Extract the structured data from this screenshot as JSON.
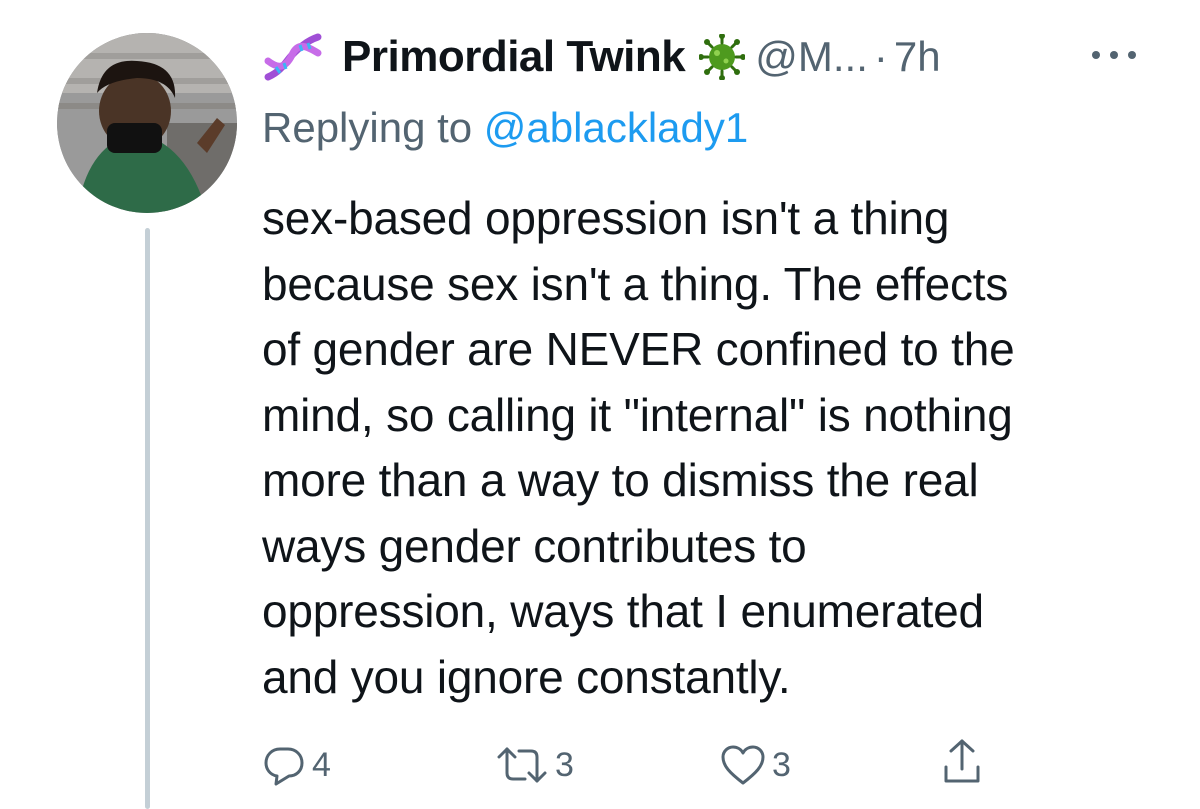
{
  "author": {
    "display_name": "Primordial Twink",
    "handle": "@M...",
    "separator": "·",
    "time": "7h",
    "name_emoji_left": "dna-icon",
    "name_emoji_right": "virus-icon"
  },
  "reply_context": {
    "prefix": "Replying to ",
    "mention": "@ablacklady1"
  },
  "tweet": {
    "text": "sex-based oppression isn't a thing\nbecause sex isn't a thing. The effects\nof gender are NEVER confined to the\nmind, so calling it \"internal\" is nothing\nmore than a way to dismiss the real\nways gender contributes to\noppression, ways that I enumerated\nand you ignore constantly."
  },
  "actions": {
    "reply_count": "4",
    "retweet_count": "3",
    "like_count": "3"
  },
  "colors": {
    "text": "#0f1419",
    "secondary": "#536471",
    "link": "#1d9bf0",
    "thread_line": "#c4cfd6"
  }
}
